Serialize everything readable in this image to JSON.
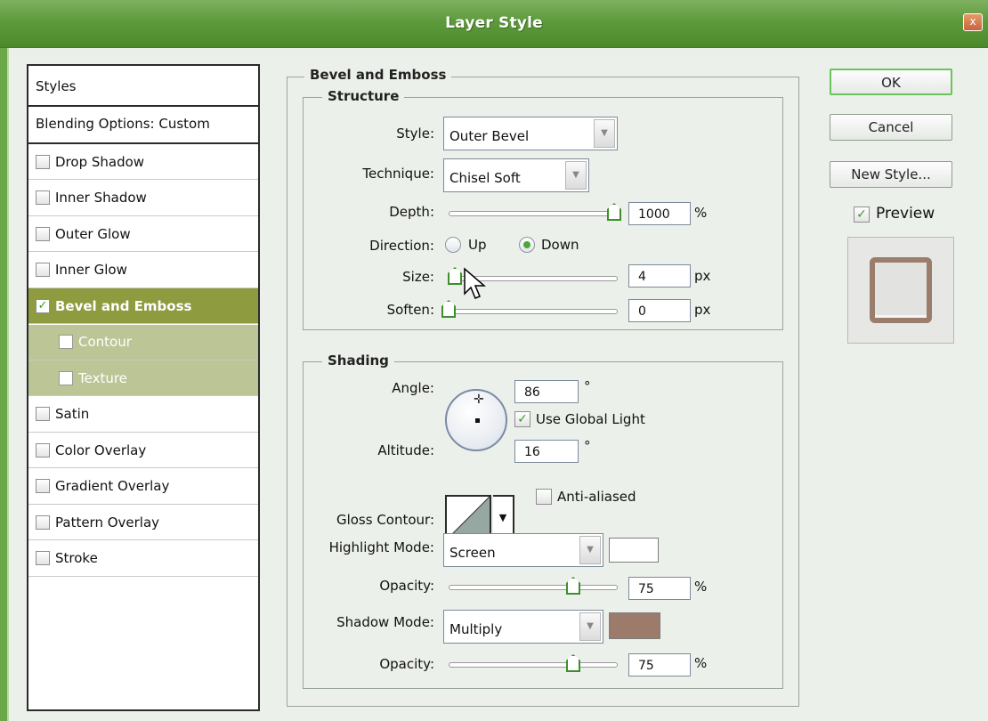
{
  "window": {
    "title": "Layer Style",
    "close_label": "x"
  },
  "styles_list": {
    "header": "Styles",
    "blending_options": "Blending Options: Custom",
    "items": [
      {
        "label": "Drop Shadow",
        "checked": false
      },
      {
        "label": "Inner Shadow",
        "checked": false
      },
      {
        "label": "Outer Glow",
        "checked": false
      },
      {
        "label": "Inner Glow",
        "checked": false
      },
      {
        "label": "Bevel and Emboss",
        "checked": true,
        "selected": true
      },
      {
        "label": "Contour",
        "checked": false,
        "sub": true
      },
      {
        "label": "Texture",
        "checked": false,
        "sub": true
      },
      {
        "label": "Satin",
        "checked": false
      },
      {
        "label": "Color Overlay",
        "checked": false
      },
      {
        "label": "Gradient Overlay",
        "checked": false
      },
      {
        "label": "Pattern Overlay",
        "checked": false
      },
      {
        "label": "Stroke",
        "checked": false
      }
    ]
  },
  "bevel_emboss": {
    "title": "Bevel and Emboss",
    "structure": {
      "title": "Structure",
      "style_label": "Style:",
      "style_value": "Outer Bevel",
      "technique_label": "Technique:",
      "technique_value": "Chisel Soft",
      "depth_label": "Depth:",
      "depth_value": "1000",
      "depth_unit": "%",
      "direction_label": "Direction:",
      "direction_up": "Up",
      "direction_down": "Down",
      "direction_selected": "Down",
      "size_label": "Size:",
      "size_value": "4",
      "size_unit": "px",
      "soften_label": "Soften:",
      "soften_value": "0",
      "soften_unit": "px"
    },
    "shading": {
      "title": "Shading",
      "angle_label": "Angle:",
      "angle_value": "86",
      "degree_symbol": "°",
      "use_global_light_label": "Use Global Light",
      "use_global_light_checked": true,
      "altitude_label": "Altitude:",
      "altitude_value": "16",
      "gloss_contour_label": "Gloss Contour:",
      "anti_aliased_label": "Anti-aliased",
      "anti_aliased_checked": false,
      "highlight_mode_label": "Highlight Mode:",
      "highlight_mode_value": "Screen",
      "highlight_color": "#ffffff",
      "highlight_opacity_label": "Opacity:",
      "highlight_opacity_value": "75",
      "shadow_mode_label": "Shadow Mode:",
      "shadow_mode_value": "Multiply",
      "shadow_color": "#9c7b6b",
      "shadow_opacity_label": "Opacity:",
      "shadow_opacity_value": "75",
      "percent_unit": "%"
    }
  },
  "buttons": {
    "ok": "OK",
    "cancel": "Cancel",
    "new_style": "New Style..."
  },
  "preview": {
    "label": "Preview",
    "checked": true
  },
  "colors": {
    "title_bar": "#5d9a3c",
    "selected_item": "#8e9b3f",
    "sub_item": "#bcc596",
    "dialog_bg": "#ecf0ea",
    "slider_thumb": "#3c8f2a"
  }
}
